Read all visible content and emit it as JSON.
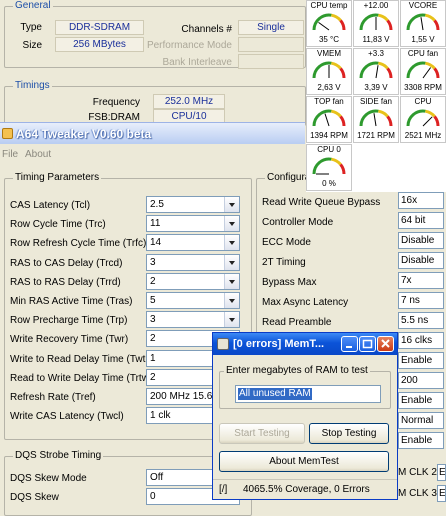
{
  "cpuz": {
    "general_legend": "General",
    "type_label": "Type",
    "type_value": "DDR-SDRAM",
    "size_label": "Size",
    "size_value": "256 MBytes",
    "channels_label": "Channels #",
    "channels_value": "Single",
    "perf_mode_label": "Performance Mode",
    "bank_interleave_label": "Bank Interleave",
    "timings_legend": "Timings",
    "frequency_label": "Frequency",
    "frequency_value": "252.0 MHz",
    "fsb_label": "FSB:DRAM",
    "fsb_value": "CPU/10"
  },
  "tweaker": {
    "title": "A64 Tweaker V0.60 beta",
    "menu": [
      "File",
      "About"
    ],
    "timing_legend": "Timing Parameters",
    "config_legend": "Configurat",
    "rows": [
      {
        "label": "CAS Latency (Tcl)",
        "value": "2.5"
      },
      {
        "label": "Row Cycle Time (Trc)",
        "value": "11"
      },
      {
        "label": "Row Refresh Cycle Time (Trfc)",
        "value": "14"
      },
      {
        "label": "RAS to CAS Delay (Trcd)",
        "value": "3"
      },
      {
        "label": "RAS to RAS Delay (Trrd)",
        "value": "2"
      },
      {
        "label": "Min RAS Active Time (Tras)",
        "value": "5"
      },
      {
        "label": "Row Precharge Time (Trp)",
        "value": "3"
      },
      {
        "label": "Write Recovery Time (Twr)",
        "value": "2"
      },
      {
        "label": "Write to Read Delay Time (Twtr)",
        "value": "1"
      },
      {
        "label": "Read to Write Delay Time (Trtw)",
        "value": "2"
      },
      {
        "label": "Refresh Rate (Tref)",
        "value": "200 MHz 15.6u"
      },
      {
        "label": "Write CAS Latency (Twcl)",
        "value": "1 clk"
      }
    ],
    "dqs_legend": "DQS Strobe Timing",
    "dqs_rows": [
      {
        "label": "DQS Skew Mode",
        "value": "Off"
      },
      {
        "label": "DQS Skew",
        "value": "0"
      }
    ],
    "config": [
      {
        "label": "Read Write Queue Bypass",
        "value": "16x"
      },
      {
        "label": "Controller Mode",
        "value": "64 bit"
      },
      {
        "label": "ECC Mode",
        "value": "Disable"
      },
      {
        "label": "2T Timing",
        "value": "Disable"
      },
      {
        "label": "Bypass Max",
        "value": "7x"
      },
      {
        "label": "Max Async Latency",
        "value": "7 ns"
      },
      {
        "label": "Read Preamble",
        "value": "5.5 ns"
      },
      {
        "label": "",
        "value": "16 clks"
      },
      {
        "label": "",
        "value": "Enable"
      },
      {
        "label": "",
        "value": "200"
      },
      {
        "label": "",
        "value": "Enable"
      },
      {
        "label": "",
        "value": "Normal"
      },
      {
        "label": "",
        "value": "Enable"
      }
    ],
    "mclk2_label": "M CLK 2",
    "mclk2_value": "E",
    "mclk3_label": "M CLK 3",
    "mclk3_value": "E"
  },
  "gauges": [
    {
      "title": "CPU temp",
      "value": "35 °C",
      "level": 0.2,
      "color": "#2e9a2e"
    },
    {
      "title": "+12.00",
      "value": "11,83 V",
      "level": 0.5,
      "color": "#2e9a2e"
    },
    {
      "title": "VCORE",
      "value": "1,55 V",
      "level": 0.45,
      "color": "#2e9a2e"
    },
    {
      "title": "VMEM",
      "value": "2,63 V",
      "level": 0.5,
      "color": "#2e9a2e"
    },
    {
      "title": "+3.3",
      "value": "3,39 V",
      "level": 0.55,
      "color": "#2e9a2e"
    },
    {
      "title": "CPU fan",
      "value": "3308 RPM",
      "level": 0.7,
      "color": "#2e9a2e"
    },
    {
      "title": "TOP fan",
      "value": "1394 RPM",
      "level": 0.4,
      "color": "#2e9a2e"
    },
    {
      "title": "SIDE fan",
      "value": "1721 RPM",
      "level": 0.45,
      "color": "#2e9a2e"
    },
    {
      "title": "CPU",
      "value": "2521 MHz",
      "level": 0.75,
      "color": "#2e9a2e"
    },
    {
      "title": "CPU 0",
      "value": "0 %",
      "level": 0.0,
      "color": "#2e9a2e"
    }
  ],
  "memtest": {
    "title": "[0 errors] MemT...",
    "group_label": "Enter megabytes of RAM to test",
    "input_value": "All unused RAM",
    "start_label": "Start Testing",
    "stop_label": "Stop Testing",
    "about_label": "About MemTest",
    "status_glyph": "[/]",
    "status_text": "4065.5% Coverage, 0 Errors"
  }
}
